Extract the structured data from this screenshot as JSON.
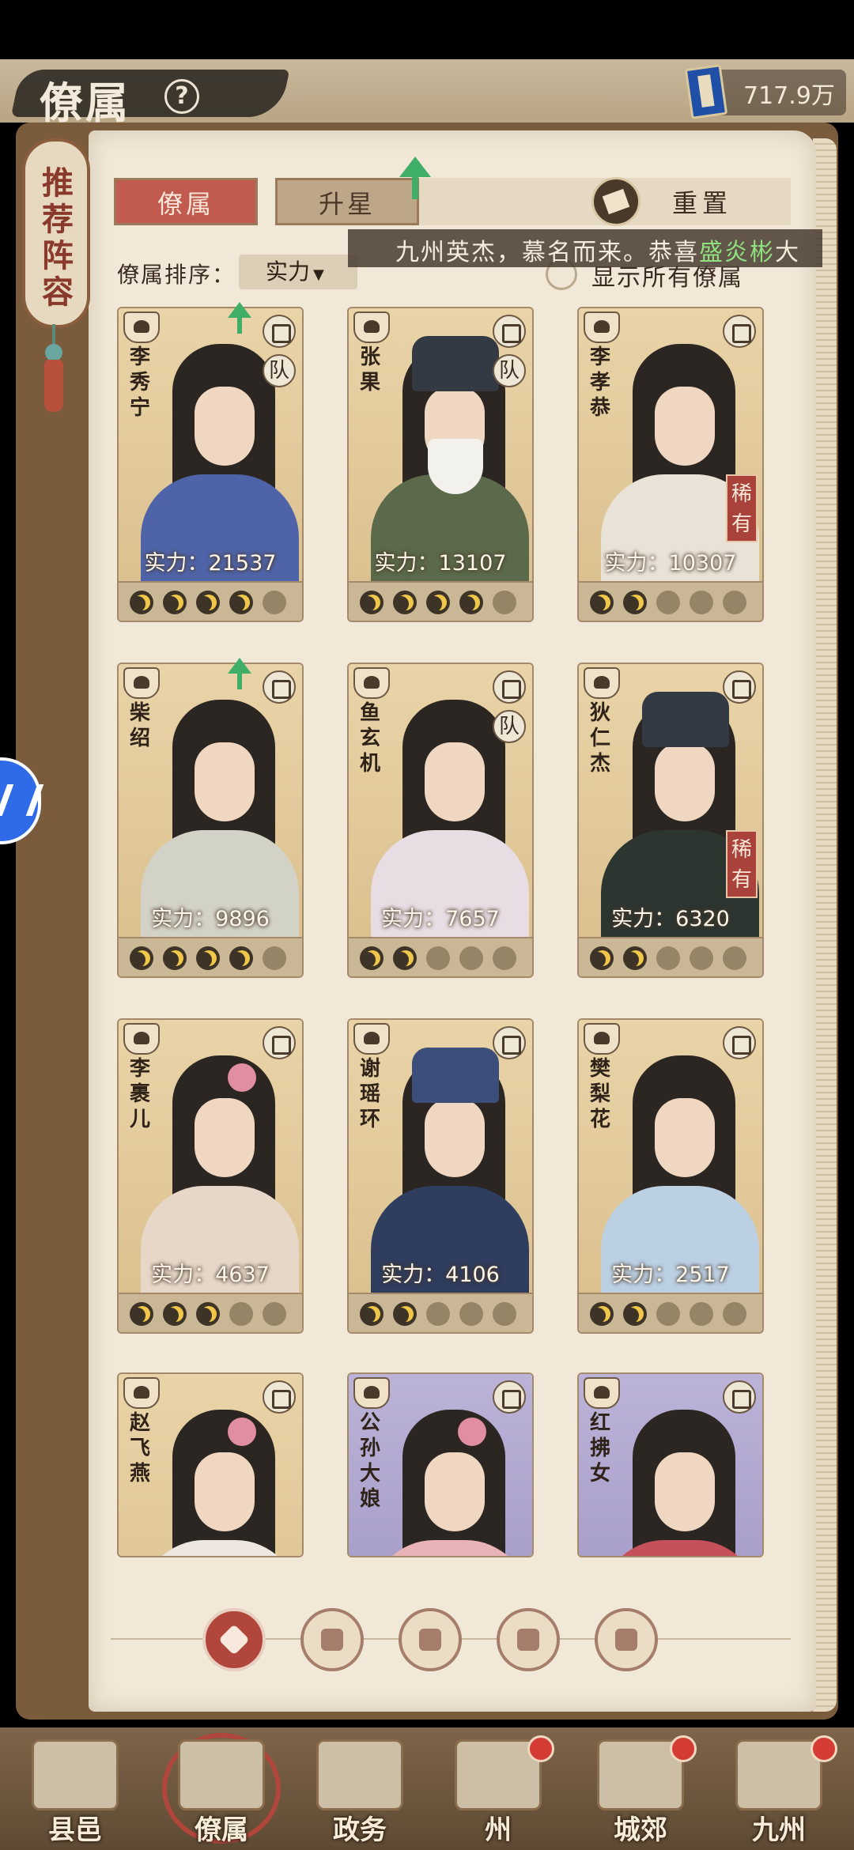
{
  "header": {
    "title": "僚属",
    "help_icon": "question-icon",
    "currency": {
      "icon": "blue-book-icon",
      "value": "717.9万"
    }
  },
  "side_banner": {
    "label": "推荐阵容"
  },
  "tabs": [
    {
      "label": "僚属",
      "active": true
    },
    {
      "label": "升星",
      "active": false
    }
  ],
  "reset": {
    "label": "重置",
    "icon": "reset-icon"
  },
  "marquee": {
    "text": "九州英杰，慕名而来。恭喜",
    "highlight": "盛炎彬",
    "tail": "大"
  },
  "sort": {
    "label": "僚属排序：",
    "value": "实力"
  },
  "show_all": {
    "label": "显示所有僚属",
    "checked": false
  },
  "power_prefix": "实力：",
  "cards": [
    {
      "name": "李秀宁",
      "power": "21537",
      "stars": 4,
      "team": "队",
      "rare": "",
      "upgrade": true,
      "bg": "gold",
      "robe": "#4f64a8"
    },
    {
      "name": "张果",
      "power": "13107",
      "stars": 4,
      "team": "队",
      "rare": "",
      "upgrade": false,
      "bg": "gold",
      "robe": "#5b6a4a"
    },
    {
      "name": "李孝恭",
      "power": "10307",
      "stars": 2,
      "team": "",
      "rare": "稀有",
      "upgrade": false,
      "bg": "gold",
      "robe": "#e9e2d6"
    },
    {
      "name": "柴绍",
      "power": "9896",
      "stars": 4,
      "team": "",
      "rare": "",
      "upgrade": true,
      "bg": "gold",
      "robe": "#d3d2c6"
    },
    {
      "name": "鱼玄机",
      "power": "7657",
      "stars": 2,
      "team": "队",
      "rare": "",
      "upgrade": false,
      "bg": "gold",
      "robe": "#e8dde2"
    },
    {
      "name": "狄仁杰",
      "power": "6320",
      "stars": 2,
      "team": "",
      "rare": "稀有",
      "upgrade": false,
      "bg": "gold",
      "robe": "#2d3531"
    },
    {
      "name": "李裹儿",
      "power": "4637",
      "stars": 3,
      "team": "",
      "rare": "",
      "upgrade": false,
      "bg": "gold",
      "robe": "#e6d7c8"
    },
    {
      "name": "谢瑶环",
      "power": "4106",
      "stars": 2,
      "team": "",
      "rare": "",
      "upgrade": false,
      "bg": "gold",
      "robe": "#2f3d5e"
    },
    {
      "name": "樊梨花",
      "power": "2517",
      "stars": 2,
      "team": "",
      "rare": "",
      "upgrade": false,
      "bg": "gold",
      "robe": "#bcd0e4"
    },
    {
      "name": "赵飞燕",
      "power": "",
      "stars": 0,
      "team": "",
      "rare": "",
      "upgrade": false,
      "bg": "gold",
      "robe": "#eee7e0"
    },
    {
      "name": "公孙大娘",
      "power": "",
      "stars": 0,
      "team": "",
      "rare": "",
      "upgrade": false,
      "bg": "purple",
      "robe": "#e8b4b8"
    },
    {
      "name": "红拂女",
      "power": "",
      "stars": 0,
      "team": "",
      "rare": "",
      "upgrade": false,
      "bg": "purple",
      "robe": "#c7515b"
    }
  ],
  "filters": [
    {
      "icon": "all-filter-icon",
      "active": true
    },
    {
      "icon": "helmet-filter-icon",
      "active": false
    },
    {
      "icon": "cat-filter-icon",
      "active": false
    },
    {
      "icon": "fan-filter-icon",
      "active": false
    },
    {
      "icon": "lion-filter-icon",
      "active": false
    }
  ],
  "nav": [
    {
      "label": "县邑",
      "dot": false
    },
    {
      "label": "僚属",
      "dot": false,
      "active": true
    },
    {
      "label": "政务",
      "dot": false
    },
    {
      "label": "州",
      "dot": true
    },
    {
      "label": "城郊",
      "dot": true
    },
    {
      "label": "九州",
      "dot": true
    }
  ],
  "colors": {
    "accent_red": "#c15a4f",
    "upgrade_green": "#3fae67",
    "page_bg": "#f1e8d8"
  }
}
